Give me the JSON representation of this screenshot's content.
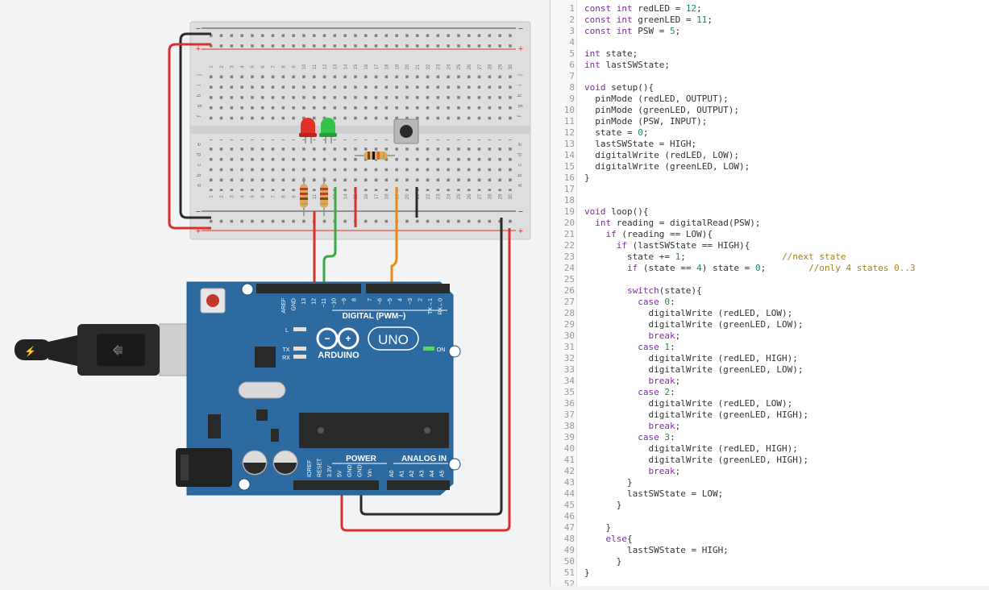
{
  "board": {
    "brand": "ARDUINO",
    "model": "UNO",
    "digital_label": "DIGITAL (PWM~)",
    "power_label": "POWER",
    "analog_label": "ANALOG IN",
    "on_label": "ON",
    "led_l": "L",
    "led_tx": "TX",
    "led_rx": "RX",
    "reset_label": "RESET",
    "digital_pins": [
      "AREF",
      "GND",
      "13",
      "12",
      "~11",
      "~10",
      "~9",
      "8",
      "7",
      "~6",
      "~5",
      "4",
      "~3",
      "2",
      "TX→1",
      "RX←0"
    ],
    "power_pins": [
      "IOREF",
      "RESET",
      "3.3V",
      "5V",
      "GND",
      "GND",
      "Vin"
    ],
    "analog_pins": [
      "A0",
      "A1",
      "A2",
      "A3",
      "A4",
      "A5"
    ]
  },
  "breadboard": {
    "rows_top": [
      "j",
      "i",
      "h",
      "g",
      "f"
    ],
    "rows_bottom": [
      "e",
      "d",
      "c",
      "b",
      "a"
    ],
    "columns": [
      "1",
      "2",
      "3",
      "4",
      "5",
      "6",
      "7",
      "8",
      "9",
      "10",
      "11",
      "12",
      "13",
      "14",
      "15",
      "16",
      "17",
      "18",
      "19",
      "20",
      "21",
      "22",
      "23",
      "24",
      "25",
      "26",
      "27",
      "28",
      "29",
      "30"
    ],
    "rail_minus": "−",
    "rail_plus": "+"
  },
  "colors": {
    "board_blue": "#2c6aa0",
    "wire_red": "#d8302e",
    "wire_black": "#2a2a2a",
    "wire_green": "#3aa843",
    "wire_orange": "#e88a1a",
    "led_red": "#e2302a",
    "led_green": "#35c24a"
  },
  "code_lines": [
    [
      [
        "kw",
        "const int"
      ],
      [
        "t",
        " redLED = "
      ],
      [
        "num",
        "12"
      ],
      [
        "t",
        ";"
      ]
    ],
    [
      [
        "kw",
        "const int"
      ],
      [
        "t",
        " greenLED = "
      ],
      [
        "num",
        "11"
      ],
      [
        "t",
        ";"
      ]
    ],
    [
      [
        "kw",
        "const int"
      ],
      [
        "t",
        " PSW = "
      ],
      [
        "num",
        "5"
      ],
      [
        "t",
        ";"
      ]
    ],
    [],
    [
      [
        "kw",
        "int"
      ],
      [
        "t",
        " state;"
      ]
    ],
    [
      [
        "kw",
        "int"
      ],
      [
        "t",
        " lastSWState;"
      ]
    ],
    [],
    [
      [
        "kw",
        "void"
      ],
      [
        "t",
        " setup(){"
      ]
    ],
    [
      [
        "t",
        "  pinMode (redLED, OUTPUT);"
      ]
    ],
    [
      [
        "t",
        "  pinMode (greenLED, OUTPUT);"
      ]
    ],
    [
      [
        "t",
        "  pinMode (PSW, INPUT);"
      ]
    ],
    [
      [
        "t",
        "  state = "
      ],
      [
        "num",
        "0"
      ],
      [
        "t",
        ";"
      ]
    ],
    [
      [
        "t",
        "  lastSWState = HIGH;"
      ]
    ],
    [
      [
        "t",
        "  digitalWrite (redLED, LOW);"
      ]
    ],
    [
      [
        "t",
        "  digitalWrite (greenLED, LOW);"
      ]
    ],
    [
      [
        "t",
        "}"
      ]
    ],
    [],
    [],
    [
      [
        "kw",
        "void"
      ],
      [
        "t",
        " loop(){"
      ]
    ],
    [
      [
        "t",
        "  "
      ],
      [
        "kw",
        "int"
      ],
      [
        "t",
        " reading = digitalRead(PSW);"
      ]
    ],
    [
      [
        "t",
        "    "
      ],
      [
        "kw",
        "if"
      ],
      [
        "t",
        " (reading == LOW){"
      ]
    ],
    [
      [
        "t",
        "      "
      ],
      [
        "kw",
        "if"
      ],
      [
        "t",
        " (lastSWState == HIGH){"
      ]
    ],
    [
      [
        "t",
        "        state += "
      ],
      [
        "num",
        "1"
      ],
      [
        "t",
        ";                  "
      ],
      [
        "cmt",
        "//next state"
      ]
    ],
    [
      [
        "t",
        "        "
      ],
      [
        "kw",
        "if"
      ],
      [
        "t",
        " (state == "
      ],
      [
        "num",
        "4"
      ],
      [
        "t",
        ") state = "
      ],
      [
        "num",
        "0"
      ],
      [
        "t",
        ";        "
      ],
      [
        "cmt",
        "//only 4 states 0..3"
      ]
    ],
    [],
    [
      [
        "t",
        "        "
      ],
      [
        "kw",
        "switch"
      ],
      [
        "t",
        "(state){"
      ]
    ],
    [
      [
        "t",
        "          "
      ],
      [
        "kw",
        "case"
      ],
      [
        "t",
        " "
      ],
      [
        "num",
        "0"
      ],
      [
        "t",
        ":"
      ]
    ],
    [
      [
        "t",
        "            digitalWrite (redLED, LOW);"
      ]
    ],
    [
      [
        "t",
        "            digitalWrite (greenLED, LOW);"
      ]
    ],
    [
      [
        "t",
        "            "
      ],
      [
        "kw",
        "break"
      ],
      [
        "t",
        ";"
      ]
    ],
    [
      [
        "t",
        "          "
      ],
      [
        "kw",
        "case"
      ],
      [
        "t",
        " "
      ],
      [
        "num",
        "1"
      ],
      [
        "t",
        ":"
      ]
    ],
    [
      [
        "t",
        "            digitalWrite (redLED, HIGH);"
      ]
    ],
    [
      [
        "t",
        "            digitalWrite (greenLED, LOW);"
      ]
    ],
    [
      [
        "t",
        "            "
      ],
      [
        "kw",
        "break"
      ],
      [
        "t",
        ";"
      ]
    ],
    [
      [
        "t",
        "          "
      ],
      [
        "kw",
        "case"
      ],
      [
        "t",
        " "
      ],
      [
        "num",
        "2"
      ],
      [
        "t",
        ":"
      ]
    ],
    [
      [
        "t",
        "            digitalWrite (redLED, LOW);"
      ]
    ],
    [
      [
        "t",
        "            digitalWrite (greenLED, HIGH);"
      ]
    ],
    [
      [
        "t",
        "            "
      ],
      [
        "kw",
        "break"
      ],
      [
        "t",
        ";"
      ]
    ],
    [
      [
        "t",
        "          "
      ],
      [
        "kw",
        "case"
      ],
      [
        "t",
        " "
      ],
      [
        "num",
        "3"
      ],
      [
        "t",
        ":"
      ]
    ],
    [
      [
        "t",
        "            digitalWrite (redLED, HIGH);"
      ]
    ],
    [
      [
        "t",
        "            digitalWrite (greenLED, HIGH);"
      ]
    ],
    [
      [
        "t",
        "            "
      ],
      [
        "kw",
        "break"
      ],
      [
        "t",
        ";"
      ]
    ],
    [
      [
        "t",
        "        }"
      ]
    ],
    [
      [
        "t",
        "        lastSWState = LOW;"
      ]
    ],
    [
      [
        "t",
        "      }"
      ]
    ],
    [],
    [
      [
        "t",
        "    }"
      ]
    ],
    [
      [
        "t",
        "    "
      ],
      [
        "kw",
        "else"
      ],
      [
        "t",
        "{"
      ]
    ],
    [
      [
        "t",
        "        lastSWState = HIGH;"
      ]
    ],
    [
      [
        "t",
        "      }"
      ]
    ],
    [
      [
        "t",
        "}"
      ]
    ],
    []
  ]
}
